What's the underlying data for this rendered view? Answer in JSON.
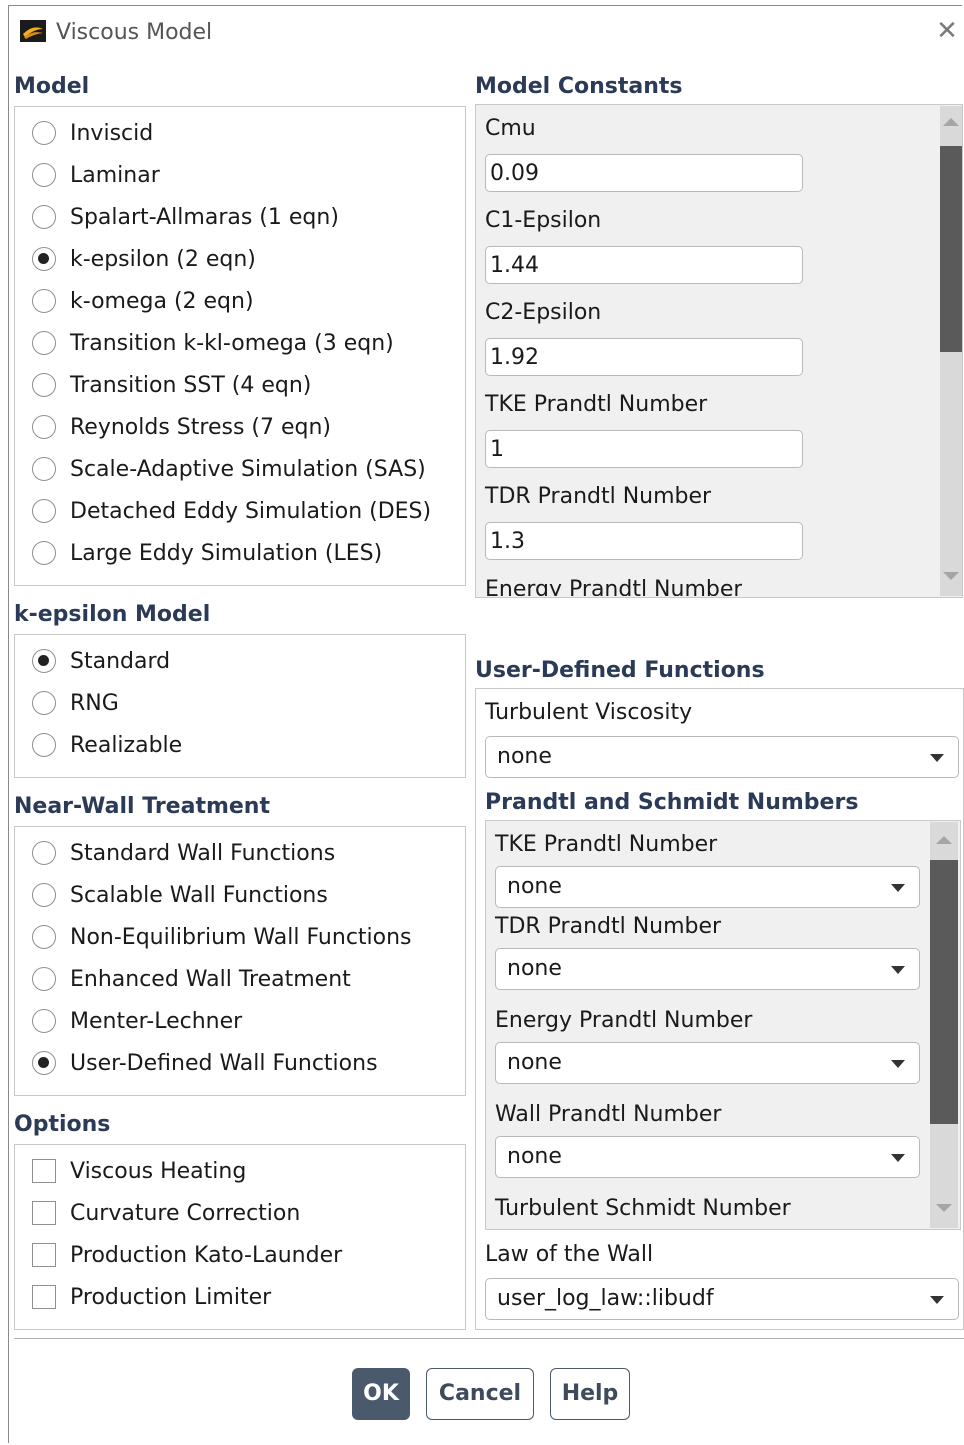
{
  "window": {
    "title": "Viscous Model",
    "close_glyph": "✕",
    "icon": "ansys-fluent-icon"
  },
  "model": {
    "heading": "Model",
    "options": [
      {
        "label": "Inviscid",
        "selected": false
      },
      {
        "label": "Laminar",
        "selected": false
      },
      {
        "label": "Spalart-Allmaras (1 eqn)",
        "selected": false
      },
      {
        "label": "k-epsilon (2 eqn)",
        "selected": true
      },
      {
        "label": "k-omega (2 eqn)",
        "selected": false
      },
      {
        "label": "Transition k-kl-omega (3 eqn)",
        "selected": false
      },
      {
        "label": "Transition SST (4 eqn)",
        "selected": false
      },
      {
        "label": "Reynolds Stress (7 eqn)",
        "selected": false
      },
      {
        "label": "Scale-Adaptive Simulation (SAS)",
        "selected": false
      },
      {
        "label": "Detached Eddy Simulation (DES)",
        "selected": false
      },
      {
        "label": "Large Eddy Simulation (LES)",
        "selected": false
      }
    ]
  },
  "kepsilon": {
    "heading": "k-epsilon Model",
    "options": [
      {
        "label": "Standard",
        "selected": true
      },
      {
        "label": "RNG",
        "selected": false
      },
      {
        "label": "Realizable",
        "selected": false
      }
    ]
  },
  "nearwall": {
    "heading": "Near-Wall Treatment",
    "options": [
      {
        "label": "Standard Wall Functions",
        "selected": false
      },
      {
        "label": "Scalable Wall Functions",
        "selected": false
      },
      {
        "label": "Non-Equilibrium Wall Functions",
        "selected": false
      },
      {
        "label": "Enhanced Wall Treatment",
        "selected": false
      },
      {
        "label": "Menter-Lechner",
        "selected": false
      },
      {
        "label": "User-Defined Wall Functions",
        "selected": true
      }
    ]
  },
  "options": {
    "heading": "Options",
    "items": [
      {
        "label": "Viscous Heating",
        "checked": false
      },
      {
        "label": "Curvature Correction",
        "checked": false
      },
      {
        "label": "Production Kato-Launder",
        "checked": false
      },
      {
        "label": "Production Limiter",
        "checked": false
      }
    ]
  },
  "constants": {
    "heading": "Model Constants",
    "items": [
      {
        "label": "Cmu",
        "value": "0.09"
      },
      {
        "label": "C1-Epsilon",
        "value": "1.44"
      },
      {
        "label": "C2-Epsilon",
        "value": "1.92"
      },
      {
        "label": "TKE Prandtl Number",
        "value": "1"
      },
      {
        "label": "TDR Prandtl Number",
        "value": "1.3"
      }
    ],
    "partial_label": "Energy Prandtl Number"
  },
  "udf": {
    "heading": "User-Defined Functions",
    "turb_visc_label": "Turbulent Viscosity",
    "turb_visc_value": "none",
    "prandtl_heading": "Prandtl and Schmidt Numbers",
    "prandtl_items": [
      {
        "label": "TKE Prandtl Number",
        "value": "none"
      },
      {
        "label": "TDR Prandtl Number",
        "value": "none"
      },
      {
        "label": "Energy Prandtl Number",
        "value": "none"
      },
      {
        "label": "Wall Prandtl Number",
        "value": "none"
      }
    ],
    "prandtl_partial_label": "Turbulent Schmidt Number",
    "law_label": "Law of the Wall",
    "law_value": "user_log_law::libudf"
  },
  "buttons": {
    "ok": "OK",
    "cancel": "Cancel",
    "help": "Help"
  }
}
